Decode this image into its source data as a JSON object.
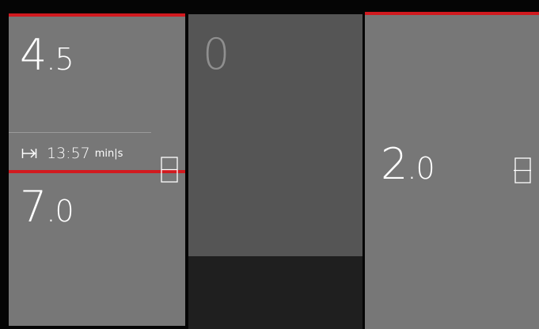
{
  "colors": {
    "accent": "#d11a1f",
    "panel": "#777777",
    "panel_inactive": "#555555",
    "background": "#050505"
  },
  "left_top": {
    "value_int": "4",
    "value_frac": ".5",
    "timer_icon": "skip-to-end-icon",
    "timer_time": "13:57",
    "timer_unit": "min|s"
  },
  "left_bottom": {
    "value_int": "7",
    "value_frac": ".0"
  },
  "middle": {
    "value": "0"
  },
  "right": {
    "value_int": "2",
    "value_frac": ".0"
  },
  "handles": {
    "left_icon": "expand-handle-icon",
    "right_icon": "expand-handle-icon"
  }
}
